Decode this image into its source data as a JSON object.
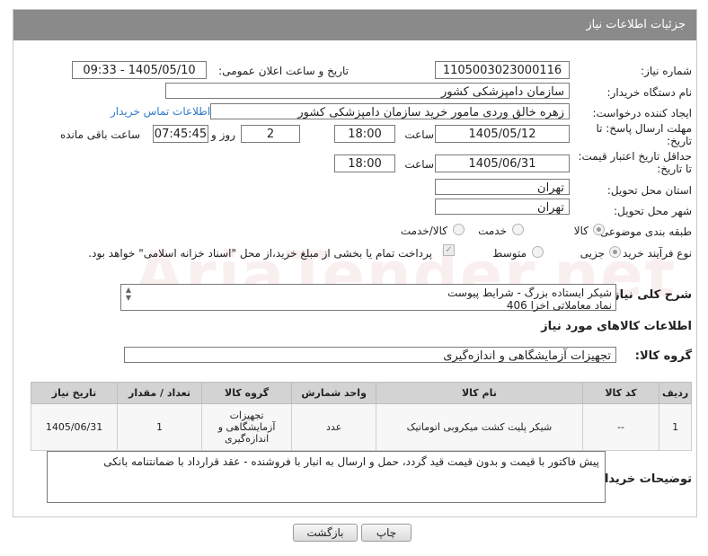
{
  "header": {
    "title": "جزئیات اطلاعات نیاز"
  },
  "fields": {
    "need_number": {
      "label": "شماره نیاز:",
      "value": "1105003023000116"
    },
    "announce_datetime": {
      "label": "تاریخ و ساعت اعلان عمومی:",
      "value": "1405/05/10 - 09:33"
    },
    "buyer_org": {
      "label": "نام دستگاه خریدار:",
      "value": "سازمان دامپزشکی کشور"
    },
    "requester": {
      "label": "ایجاد کننده درخواست:",
      "value": "زهره خالق وردی مامور خرید سازمان دامپزشکی کشور"
    },
    "buyer_contact_link": "اطلاعات تماس خریدار",
    "reply_deadline": {
      "label_line1": "مهلت ارسال پاسخ: تا",
      "label_line2": "تاریخ:",
      "date": "1405/05/12",
      "time_label": "ساعت",
      "time": "18:00",
      "days": "2",
      "days_label": "روز و",
      "remaining": "07:45:45",
      "remaining_label": "ساعت باقی مانده"
    },
    "price_validity": {
      "label_line1": "حداقل تاریخ اعتبار قیمت:",
      "label_line2": "تا تاریخ:",
      "date": "1405/06/31",
      "time_label": "ساعت",
      "time": "18:00"
    },
    "delivery_province": {
      "label": "استان محل تحویل:",
      "value": "تهران"
    },
    "delivery_city": {
      "label": "شهر محل تحویل:",
      "value": "تهران"
    },
    "subject_category": {
      "label": "طبقه بندی موضوعی:",
      "options": [
        "کالا",
        "خدمت",
        "کالا/خدمت"
      ],
      "selected": "کالا"
    },
    "purchase_process": {
      "label": "نوع فرآیند خرید :",
      "options": [
        "جزیی",
        "متوسط"
      ],
      "selected": "جزیی",
      "payment_note": "پرداخت تمام یا بخشی از مبلغ خرید،از محل \"اسناد خزانه اسلامی\" خواهد بود."
    }
  },
  "general_description": {
    "label": "شرح کلی نیاز:",
    "line1": "شیکر ایستاده بزرگ - شرایط پیوست",
    "line2": "نماد معاملاتی اخزا 406"
  },
  "goods_info": {
    "title": "اطلاعات کالاهای مورد نیاز",
    "group_label": "گروه کالا:",
    "group_value": "تجهیزات آزمایشگاهی و اندازه‌گیری"
  },
  "items_table": {
    "columns": [
      "ردیف",
      "کد کالا",
      "نام کالا",
      "واحد شمارش",
      "گروه کالا",
      "تعداد / مقدار",
      "تاریخ نیاز"
    ],
    "rows": [
      {
        "row": "1",
        "code": "--",
        "name": "شیکر پلیت کشت میکروبی اتوماتیک",
        "unit": "عدد",
        "group": "تجهیزات آزمایشگاهی و اندازه‌گیری",
        "qty": "1",
        "date": "1405/06/31"
      }
    ]
  },
  "buyer_notes": {
    "label": "توضیحات خریدار:",
    "value": "پیش فاکتور با قیمت و بدون قیمت قید گردد، حمل و ارسال به انبار با فروشنده -  عقد قرارداد با ضمانتنامه بانکی"
  },
  "buttons": {
    "print": "چاپ",
    "back": "بازگشت"
  },
  "watermark": "AriaTender.net"
}
